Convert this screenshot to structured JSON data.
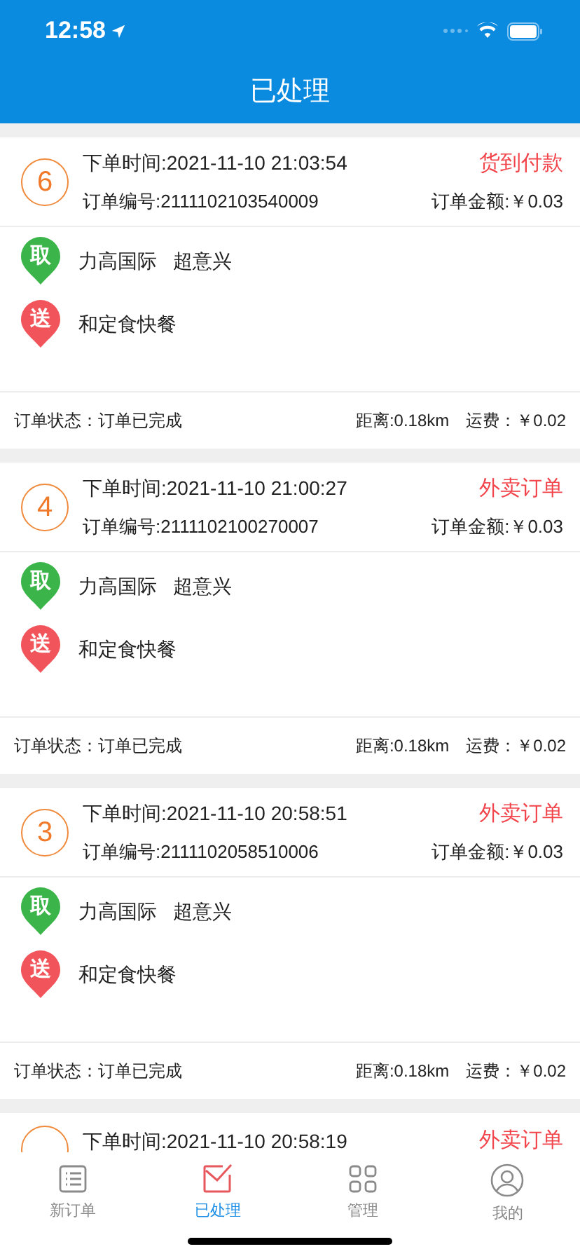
{
  "status_bar": {
    "time": "12:58"
  },
  "header": {
    "title": "已处理"
  },
  "orders": [
    {
      "number": "6",
      "order_time": "下单时间:2021-11-10 21:03:54",
      "type": "货到付款",
      "order_id": "订单编号:2111102103540009",
      "amount": "订单金额:￥0.03",
      "stops": [
        {
          "kind": "pickup",
          "badge": "取",
          "text": "力高国际   超意兴"
        },
        {
          "kind": "delivery",
          "badge": "送",
          "text": "和定食快餐"
        }
      ],
      "status": "订单状态：订单已完成",
      "distance": "距离:0.18km",
      "fee": "运费：￥0.02"
    },
    {
      "number": "4",
      "order_time": "下单时间:2021-11-10 21:00:27",
      "type": "外卖订单",
      "order_id": "订单编号:2111102100270007",
      "amount": "订单金额:￥0.03",
      "stops": [
        {
          "kind": "pickup",
          "badge": "取",
          "text": "力高国际   超意兴"
        },
        {
          "kind": "delivery",
          "badge": "送",
          "text": "和定食快餐"
        }
      ],
      "status": "订单状态：订单已完成",
      "distance": "距离:0.18km",
      "fee": "运费：￥0.02"
    },
    {
      "number": "3",
      "order_time": "下单时间:2021-11-10 20:58:51",
      "type": "外卖订单",
      "order_id": "订单编号:2111102058510006",
      "amount": "订单金额:￥0.03",
      "stops": [
        {
          "kind": "pickup",
          "badge": "取",
          "text": "力高国际   超意兴"
        },
        {
          "kind": "delivery",
          "badge": "送",
          "text": "和定食快餐"
        }
      ],
      "status": "订单状态：订单已完成",
      "distance": "距离:0.18km",
      "fee": "运费：￥0.02"
    },
    {
      "order_time": "下单时间:2021-11-10 20:58:19",
      "type": "外卖订单"
    }
  ],
  "tab_bar": [
    {
      "kind": "list",
      "label": "新订单",
      "selected": false
    },
    {
      "kind": "mail",
      "label": "已处理",
      "selected": true
    },
    {
      "kind": "grid",
      "label": "管理",
      "selected": false
    },
    {
      "kind": "user",
      "label": "我的",
      "selected": false
    }
  ]
}
